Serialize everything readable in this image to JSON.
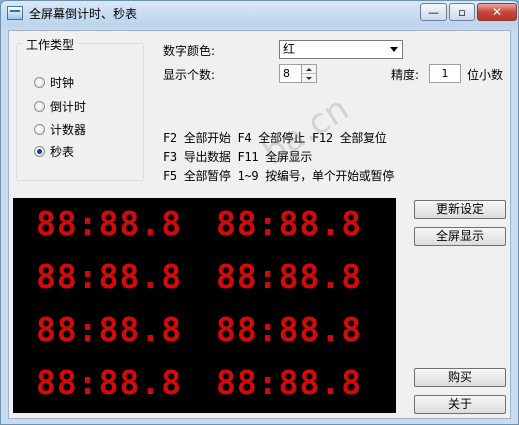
{
  "window": {
    "title": "全屏幕倒计时、秒表",
    "controls": {
      "minimize": "—",
      "maximize": "▫",
      "close": "✕"
    }
  },
  "mode_group": {
    "title": "工作类型",
    "options": [
      {
        "label": "时钟",
        "selected": false
      },
      {
        "label": "倒计时",
        "selected": false
      },
      {
        "label": "计数器",
        "selected": false
      },
      {
        "label": "秒表",
        "selected": true
      }
    ]
  },
  "settings": {
    "color_label": "数字颜色:",
    "color_value": "红",
    "count_label": "显示个数:",
    "count_value": "8",
    "precision_label": "精度:",
    "precision_value": "1",
    "precision_unit": "位小数"
  },
  "hotkeys": [
    "F2 全部开始 F4 全部停止 F12 全部复位",
    "F3 导出数据 F11 全屏显示",
    "F5 全部暂停 1~9 按编号，单个开始或暂停"
  ],
  "display": {
    "digit_color": "#d40a0a",
    "timers": [
      "88:88.8",
      "88:88.8",
      "88:88.8",
      "88:88.8",
      "88:88.8",
      "88:88.8",
      "88:88.8",
      "88:88.8"
    ]
  },
  "buttons": {
    "update": "更新设定",
    "fullscreen": "全屏显示",
    "buy": "购买",
    "about": "关于"
  },
  "watermark": "ba.cn"
}
